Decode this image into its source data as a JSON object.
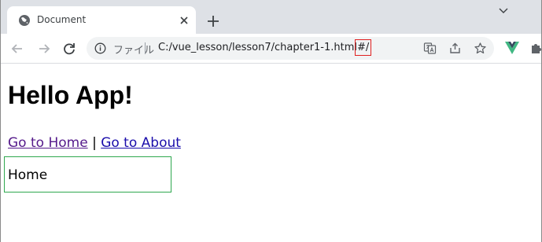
{
  "browser": {
    "tab": {
      "title": "Document",
      "favicon": "globe-icon"
    },
    "newtab_icon": "plus-icon",
    "omnibox": {
      "scheme_label": "ファイル",
      "url_main": "C:/vue_lesson/lesson7/chapter1-1.html",
      "url_hash": "#/"
    }
  },
  "page": {
    "heading": "Hello App!",
    "nav": {
      "home_link": "Go to Home",
      "separator": "|",
      "about_link": "Go to About"
    },
    "router_view": {
      "text": "Home"
    }
  },
  "colors": {
    "tabstrip_bg": "#dee1e6",
    "visited_link": "#551a8b",
    "link": "#1a0dab",
    "hash_highlight": "#e02020",
    "router_view_border": "#2fa84f"
  }
}
